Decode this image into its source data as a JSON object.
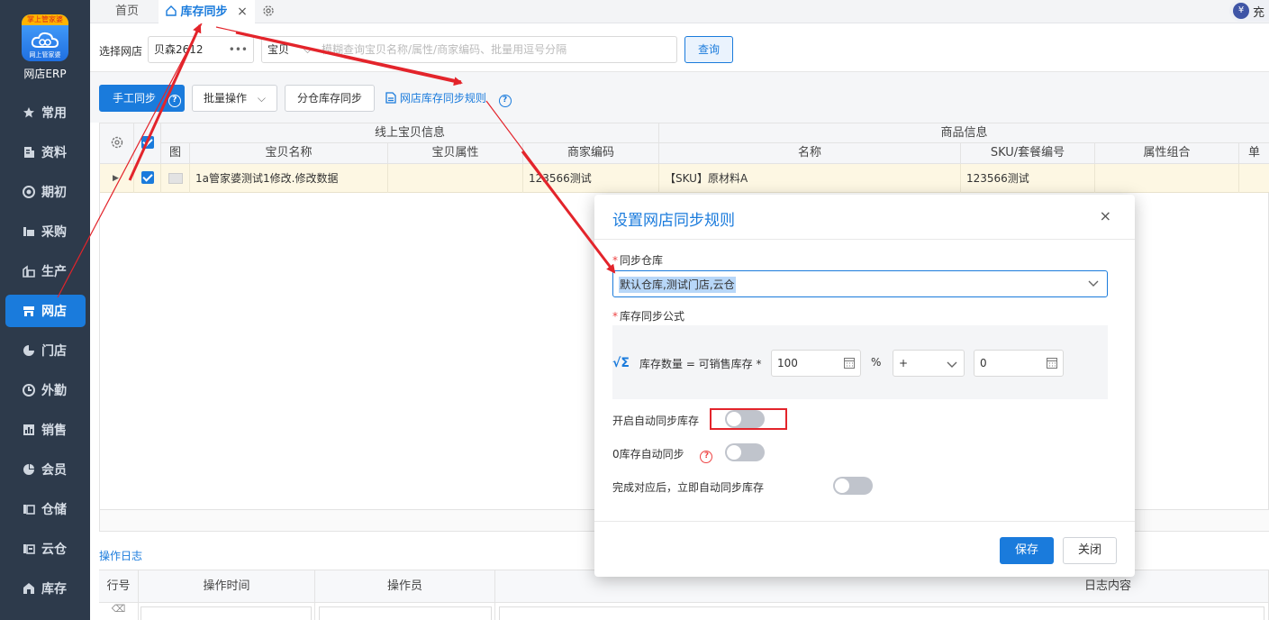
{
  "sidebar": {
    "logo_banner": "掌上管家婆",
    "logo_sub": "网上管家婆",
    "brand": "网店ERP",
    "items": [
      {
        "label": "常用",
        "icon": "star-icon"
      },
      {
        "label": "资料",
        "icon": "document-icon"
      },
      {
        "label": "期初",
        "icon": "target-icon"
      },
      {
        "label": "采购",
        "icon": "purchase-icon"
      },
      {
        "label": "生产",
        "icon": "factory-icon"
      },
      {
        "label": "网店",
        "icon": "store-icon"
      },
      {
        "label": "门店",
        "icon": "shop-icon"
      },
      {
        "label": "外勤",
        "icon": "field-icon"
      },
      {
        "label": "销售",
        "icon": "chart-icon"
      },
      {
        "label": "会员",
        "icon": "member-icon"
      },
      {
        "label": "仓储",
        "icon": "warehouse-icon"
      },
      {
        "label": "云仓",
        "icon": "cloud-warehouse-icon"
      },
      {
        "label": "库存",
        "icon": "inventory-icon"
      }
    ]
  },
  "tabs": {
    "home": "首页",
    "active": "库存同步",
    "close": "×",
    "top_right_label": "充"
  },
  "search": {
    "shop_label": "选择网店",
    "shop_value": "贝森2612",
    "type_value": "宝贝",
    "keyword_placeholder": "模糊查询宝贝名称/属性/商家编码、批量用逗号分隔",
    "query_button": "查询"
  },
  "toolbar": {
    "manual_sync": "手工同步",
    "batch_ops": "批量操作",
    "split_warehouse_sync": "分仓库存同步",
    "rule_link": "网店库存同步规则"
  },
  "grid": {
    "group_online": "线上宝贝信息",
    "group_goods": "商品信息",
    "columns": [
      "图",
      "宝贝名称",
      "宝贝属性",
      "商家编码",
      "名称",
      "SKU/套餐编号",
      "属性组合",
      "单"
    ],
    "row": {
      "name": "1a管家婆测试1修改.修改数据",
      "attr": "",
      "code": "123566测试",
      "goods_name": "【SKU】原材料A",
      "sku": "123566测试",
      "combo": ""
    }
  },
  "log": {
    "title": "操作日志",
    "columns": [
      "行号",
      "操作时间",
      "操作员",
      "日志内容"
    ]
  },
  "modal": {
    "title": "设置网店同步规则",
    "close": "×",
    "warehouse_label": "同步仓库",
    "warehouse_value": "默认仓库,测试门店,云仓",
    "formula_label": "库存同步公式",
    "formula_text": "库存数量 = 可销售库存 *",
    "percent_value": "100",
    "percent_sign": "%",
    "operator_value": "+",
    "offset_value": "0",
    "auto_sync_label": "开启自动同步库存",
    "zero_sync_label": "0库存自动同步",
    "after_match_label": "完成对应后，立即自动同步库存",
    "auto_sync_on": false,
    "zero_sync_on": false,
    "after_match_on": false,
    "save": "保存",
    "close_button": "关闭"
  },
  "colors": {
    "accent": "#1a7bdc",
    "sidebar_bg": "#2d3a4b",
    "annotation_red": "#e3242b",
    "row_highlight": "#fdf7e3"
  }
}
